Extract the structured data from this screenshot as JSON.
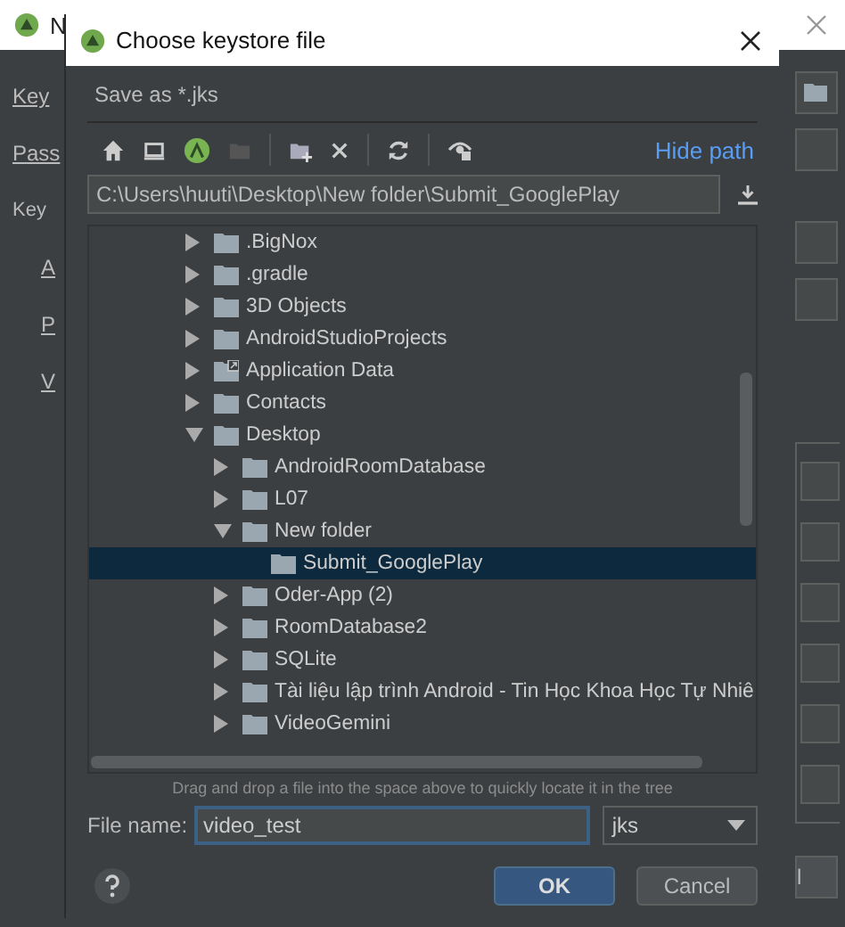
{
  "background_window": {
    "title": "N",
    "labels": [
      {
        "text": "Key",
        "kind": "field"
      },
      {
        "text": "Pass",
        "kind": "field"
      },
      {
        "text": "Key",
        "kind": "heading"
      },
      {
        "text": "A",
        "kind": "field"
      },
      {
        "text": "P",
        "kind": "field"
      },
      {
        "text": "V",
        "kind": "field"
      }
    ],
    "button_fragment": "l"
  },
  "dialog": {
    "title": "Choose keystore file",
    "description": "Save as *.jks",
    "hide_path_link": "Hide path",
    "path": "C:\\Users\\huuti\\Desktop\\New folder\\Submit_GooglePlay",
    "tree": [
      {
        "label": ".BigNox",
        "expanded": false,
        "selected": false,
        "shortcut": false
      },
      {
        "label": ".gradle",
        "expanded": false,
        "selected": false,
        "shortcut": false
      },
      {
        "label": "3D Objects",
        "expanded": false,
        "selected": false,
        "shortcut": false
      },
      {
        "label": "AndroidStudioProjects",
        "expanded": false,
        "selected": false,
        "shortcut": false
      },
      {
        "label": "Application Data",
        "expanded": false,
        "selected": false,
        "shortcut": true
      },
      {
        "label": "Contacts",
        "expanded": false,
        "selected": false,
        "shortcut": false
      },
      {
        "label": "Desktop",
        "expanded": true,
        "selected": false,
        "shortcut": false,
        "children": [
          {
            "label": "AndroidRoomDatabase",
            "expanded": false,
            "selected": false,
            "shortcut": false
          },
          {
            "label": "L07",
            "expanded": false,
            "selected": false,
            "shortcut": false
          },
          {
            "label": "New folder",
            "expanded": true,
            "selected": false,
            "shortcut": false,
            "children": [
              {
                "label": "Submit_GooglePlay",
                "selected": true,
                "shortcut": false
              }
            ]
          },
          {
            "label": "Oder-App (2)",
            "expanded": false,
            "selected": false,
            "shortcut": false
          },
          {
            "label": "RoomDatabase2",
            "expanded": false,
            "selected": false,
            "shortcut": false
          },
          {
            "label": "SQLite",
            "expanded": false,
            "selected": false,
            "shortcut": false
          },
          {
            "label": "Tài liệu lập trình Android - Tin Học Khoa Học Tự Nhiê",
            "expanded": false,
            "selected": false,
            "shortcut": false
          },
          {
            "label": "VideoGemini",
            "expanded": false,
            "selected": false,
            "shortcut": false
          }
        ]
      }
    ],
    "hint": "Drag and drop a file into the space above to quickly locate it in the tree",
    "file_name_label": "File name:",
    "file_name": "video_test",
    "file_type": "jks",
    "buttons": [
      {
        "label": "OK",
        "kind": "primary"
      },
      {
        "label": "Cancel",
        "kind": "secondary"
      }
    ]
  }
}
